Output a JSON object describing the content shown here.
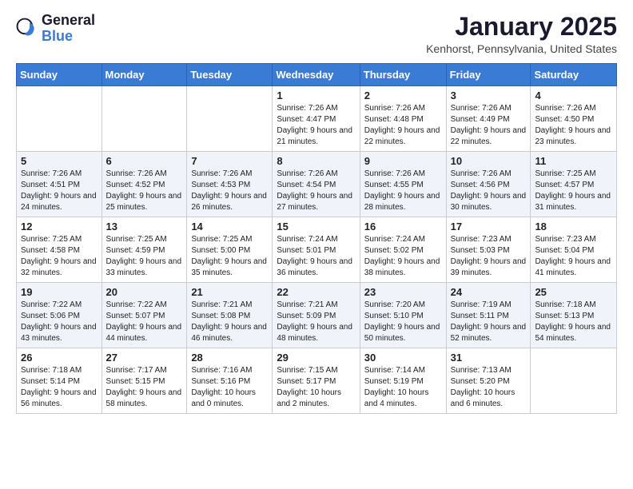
{
  "header": {
    "logo_line1": "General",
    "logo_line2": "Blue",
    "month": "January 2025",
    "location": "Kenhorst, Pennsylvania, United States"
  },
  "days_of_week": [
    "Sunday",
    "Monday",
    "Tuesday",
    "Wednesday",
    "Thursday",
    "Friday",
    "Saturday"
  ],
  "weeks": [
    [
      {
        "day": "",
        "sunrise": "",
        "sunset": "",
        "daylight": ""
      },
      {
        "day": "",
        "sunrise": "",
        "sunset": "",
        "daylight": ""
      },
      {
        "day": "",
        "sunrise": "",
        "sunset": "",
        "daylight": ""
      },
      {
        "day": "1",
        "sunrise": "7:26 AM",
        "sunset": "4:47 PM",
        "daylight": "9 hours and 21 minutes."
      },
      {
        "day": "2",
        "sunrise": "7:26 AM",
        "sunset": "4:48 PM",
        "daylight": "9 hours and 22 minutes."
      },
      {
        "day": "3",
        "sunrise": "7:26 AM",
        "sunset": "4:49 PM",
        "daylight": "9 hours and 22 minutes."
      },
      {
        "day": "4",
        "sunrise": "7:26 AM",
        "sunset": "4:50 PM",
        "daylight": "9 hours and 23 minutes."
      }
    ],
    [
      {
        "day": "5",
        "sunrise": "7:26 AM",
        "sunset": "4:51 PM",
        "daylight": "9 hours and 24 minutes."
      },
      {
        "day": "6",
        "sunrise": "7:26 AM",
        "sunset": "4:52 PM",
        "daylight": "9 hours and 25 minutes."
      },
      {
        "day": "7",
        "sunrise": "7:26 AM",
        "sunset": "4:53 PM",
        "daylight": "9 hours and 26 minutes."
      },
      {
        "day": "8",
        "sunrise": "7:26 AM",
        "sunset": "4:54 PM",
        "daylight": "9 hours and 27 minutes."
      },
      {
        "day": "9",
        "sunrise": "7:26 AM",
        "sunset": "4:55 PM",
        "daylight": "9 hours and 28 minutes."
      },
      {
        "day": "10",
        "sunrise": "7:26 AM",
        "sunset": "4:56 PM",
        "daylight": "9 hours and 30 minutes."
      },
      {
        "day": "11",
        "sunrise": "7:25 AM",
        "sunset": "4:57 PM",
        "daylight": "9 hours and 31 minutes."
      }
    ],
    [
      {
        "day": "12",
        "sunrise": "7:25 AM",
        "sunset": "4:58 PM",
        "daylight": "9 hours and 32 minutes."
      },
      {
        "day": "13",
        "sunrise": "7:25 AM",
        "sunset": "4:59 PM",
        "daylight": "9 hours and 33 minutes."
      },
      {
        "day": "14",
        "sunrise": "7:25 AM",
        "sunset": "5:00 PM",
        "daylight": "9 hours and 35 minutes."
      },
      {
        "day": "15",
        "sunrise": "7:24 AM",
        "sunset": "5:01 PM",
        "daylight": "9 hours and 36 minutes."
      },
      {
        "day": "16",
        "sunrise": "7:24 AM",
        "sunset": "5:02 PM",
        "daylight": "9 hours and 38 minutes."
      },
      {
        "day": "17",
        "sunrise": "7:23 AM",
        "sunset": "5:03 PM",
        "daylight": "9 hours and 39 minutes."
      },
      {
        "day": "18",
        "sunrise": "7:23 AM",
        "sunset": "5:04 PM",
        "daylight": "9 hours and 41 minutes."
      }
    ],
    [
      {
        "day": "19",
        "sunrise": "7:22 AM",
        "sunset": "5:06 PM",
        "daylight": "9 hours and 43 minutes."
      },
      {
        "day": "20",
        "sunrise": "7:22 AM",
        "sunset": "5:07 PM",
        "daylight": "9 hours and 44 minutes."
      },
      {
        "day": "21",
        "sunrise": "7:21 AM",
        "sunset": "5:08 PM",
        "daylight": "9 hours and 46 minutes."
      },
      {
        "day": "22",
        "sunrise": "7:21 AM",
        "sunset": "5:09 PM",
        "daylight": "9 hours and 48 minutes."
      },
      {
        "day": "23",
        "sunrise": "7:20 AM",
        "sunset": "5:10 PM",
        "daylight": "9 hours and 50 minutes."
      },
      {
        "day": "24",
        "sunrise": "7:19 AM",
        "sunset": "5:11 PM",
        "daylight": "9 hours and 52 minutes."
      },
      {
        "day": "25",
        "sunrise": "7:18 AM",
        "sunset": "5:13 PM",
        "daylight": "9 hours and 54 minutes."
      }
    ],
    [
      {
        "day": "26",
        "sunrise": "7:18 AM",
        "sunset": "5:14 PM",
        "daylight": "9 hours and 56 minutes."
      },
      {
        "day": "27",
        "sunrise": "7:17 AM",
        "sunset": "5:15 PM",
        "daylight": "9 hours and 58 minutes."
      },
      {
        "day": "28",
        "sunrise": "7:16 AM",
        "sunset": "5:16 PM",
        "daylight": "10 hours and 0 minutes."
      },
      {
        "day": "29",
        "sunrise": "7:15 AM",
        "sunset": "5:17 PM",
        "daylight": "10 hours and 2 minutes."
      },
      {
        "day": "30",
        "sunrise": "7:14 AM",
        "sunset": "5:19 PM",
        "daylight": "10 hours and 4 minutes."
      },
      {
        "day": "31",
        "sunrise": "7:13 AM",
        "sunset": "5:20 PM",
        "daylight": "10 hours and 6 minutes."
      },
      {
        "day": "",
        "sunrise": "",
        "sunset": "",
        "daylight": ""
      }
    ]
  ],
  "labels": {
    "sunrise_prefix": "Sunrise: ",
    "sunset_prefix": "Sunset: ",
    "daylight_prefix": "Daylight: "
  }
}
